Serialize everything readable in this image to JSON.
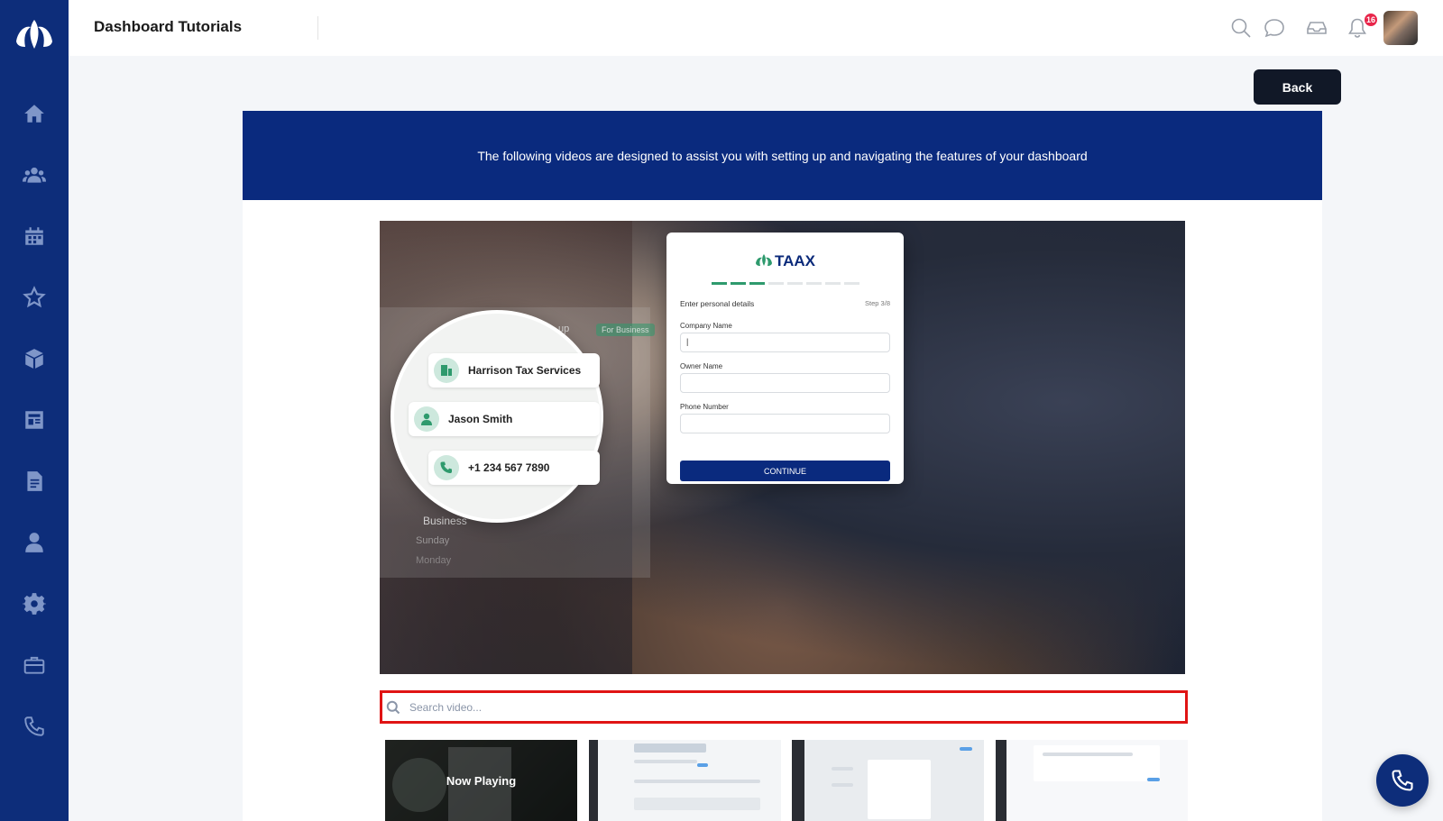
{
  "app": {
    "title": "Dashboard Tutorials",
    "notification_count": "16"
  },
  "sidebar": {
    "logo_icon": "lotus-logo-icon",
    "items": [
      {
        "icon": "home-icon"
      },
      {
        "icon": "users-group-icon"
      },
      {
        "icon": "calendar-icon"
      },
      {
        "icon": "star-icon"
      },
      {
        "icon": "box-icon"
      },
      {
        "icon": "newspaper-icon"
      },
      {
        "icon": "document-icon"
      },
      {
        "icon": "user-icon"
      },
      {
        "icon": "gear-icon"
      },
      {
        "icon": "briefcase-icon"
      },
      {
        "icon": "phone-icon"
      }
    ]
  },
  "topbar": {
    "icons": [
      "search-icon",
      "chat-icon",
      "inbox-icon",
      "bell-icon"
    ]
  },
  "actions": {
    "back_label": "Back"
  },
  "banner": {
    "text": "The following videos are designed to assist you with setting up and navigating the features of your dashboard"
  },
  "video": {
    "magnifier_rows": [
      {
        "text": "Harrison Tax Services",
        "icon": "building-icon"
      },
      {
        "text": "Jason Smith",
        "icon": "user-icon"
      },
      {
        "text": "+1 234 567 7890",
        "icon": "phone-icon"
      }
    ],
    "background_texts": [
      "up",
      "For Business",
      "Business",
      "Sunday",
      "Monday"
    ],
    "card": {
      "brand": "TAAX",
      "steps_total": 8,
      "steps_done": 3,
      "heading": "Enter personal details",
      "step_label": "Step 3/8",
      "fields": [
        {
          "label": "Company Name",
          "value": "|"
        },
        {
          "label": "Owner Name",
          "value": ""
        },
        {
          "label": "Phone Number",
          "value": ""
        }
      ],
      "cta": "CONTINUE"
    }
  },
  "search": {
    "placeholder": "Search video...",
    "value": ""
  },
  "thumbnails": [
    {
      "status": "Now Playing"
    },
    {
      "status": ""
    },
    {
      "status": ""
    },
    {
      "status": ""
    }
  ],
  "colors": {
    "brand_navy": "#0d2d7a",
    "banner_navy": "#0a2a7e",
    "accent_green": "#2e9a6d",
    "highlight_red": "#e01414",
    "badge_red": "#e8254a"
  }
}
